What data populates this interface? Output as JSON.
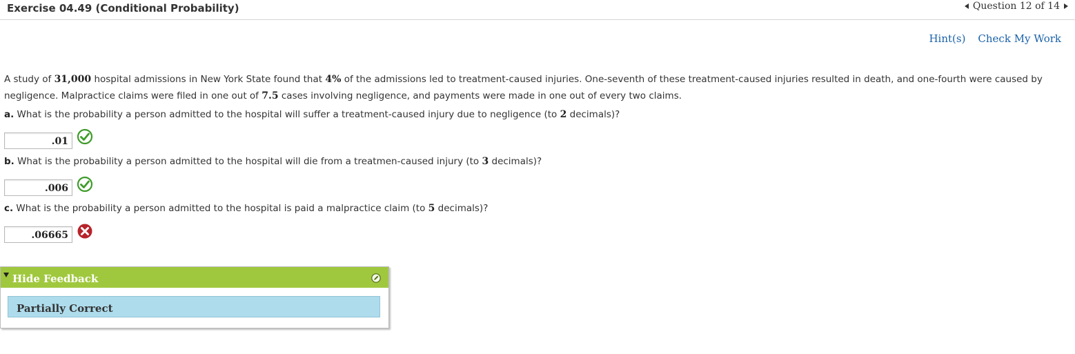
{
  "header": {
    "title": "Exercise 04.49 (Conditional Probability)",
    "question_nav": "Question 12 of 14"
  },
  "actions": {
    "hints": "Hint(s)",
    "check": "Check My Work"
  },
  "question": {
    "text_1": "A study of ",
    "n_admissions": "31,000",
    "text_2": " hospital admissions in New York State found that ",
    "pct": "4%",
    "text_3": " of the admissions led to treatment-caused injuries. One-seventh of these treatment-caused injuries resulted in death, and one-fourth were caused by negligence. Malpractice claims were filed in one out of ",
    "ratio": "7.5",
    "text_4": " cases involving negligence, and payments were made in one out of every two claims."
  },
  "parts": [
    {
      "letter": "a.",
      "text_before": " What is the probability a person admitted to the hospital will suffer a treatment-caused injury due to negligence (to ",
      "decimals": "2",
      "text_after": " decimals)?",
      "answer": ".01",
      "status": "correct"
    },
    {
      "letter": "b.",
      "text_before": " What is the probability a person admitted to the hospital will die from a treatmen-caused injury (to ",
      "decimals": "3",
      "text_after": " decimals)?",
      "answer": ".006",
      "status": "correct"
    },
    {
      "letter": "c.",
      "text_before": " What is the probability a person admitted to the hospital is paid a malpractice claim (to ",
      "decimals": "5",
      "text_after": " decimals)?",
      "answer": ".06665",
      "status": "incorrect"
    }
  ],
  "feedback": {
    "toggle_label": "Hide Feedback",
    "result": "Partially Correct"
  },
  "colors": {
    "link": "#1a62a8",
    "feedback_header": "#a0c83e",
    "feedback_body": "#aedcec",
    "correct": "#3f9b2a",
    "incorrect": "#b8232a"
  }
}
